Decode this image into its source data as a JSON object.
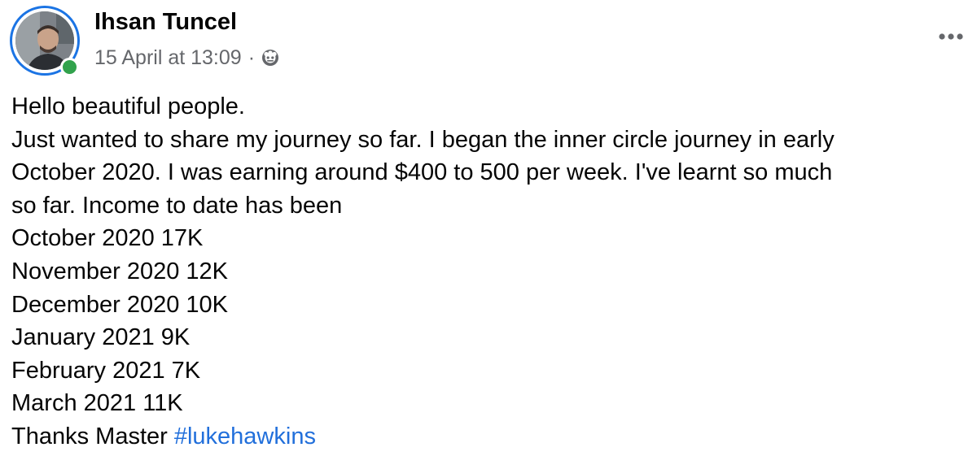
{
  "post": {
    "author": {
      "name": "Ihsan Tuncel",
      "online": true
    },
    "timestamp": "15 April at 13:09",
    "separator": "·",
    "audience_icon": "custom-audience-icon",
    "more_icon": "more-options-icon",
    "body_lines": [
      "Hello beautiful people.",
      "Just wanted to share my journey so far. I began the inner circle journey in early",
      "October 2020. I was earning around $400 to 500 per week. I've learnt so much",
      "so far. Income to date has been",
      "October 2020 17K",
      "November 2020 12K",
      "December 2020 10K",
      "January 2021 9K",
      "February 2021 7K",
      "March 2021 11K"
    ],
    "closing_text": "Thanks Master ",
    "hashtag": "#lukehawkins"
  },
  "colors": {
    "text": "#050505",
    "secondary_text": "#65676b",
    "link": "#216fdb",
    "avatar_ring": "#1b74e4",
    "online": "#31a24c"
  }
}
